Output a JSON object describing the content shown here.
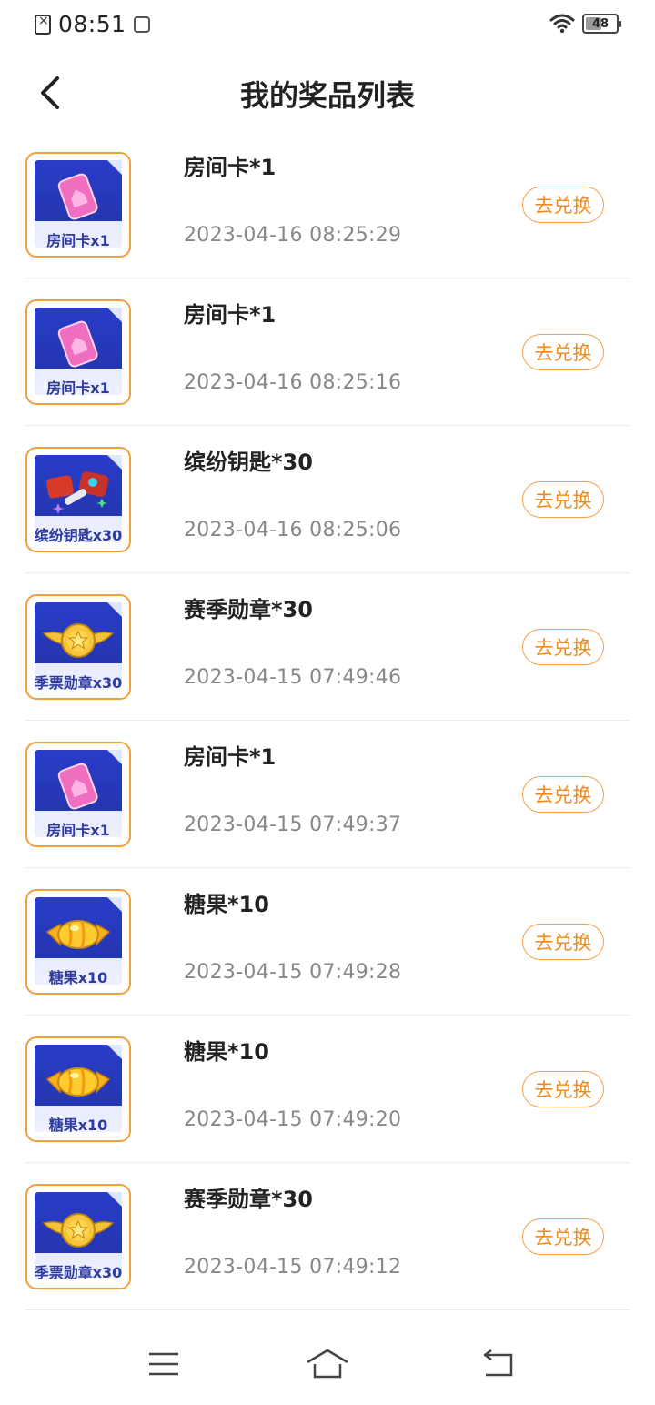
{
  "status_bar": {
    "time": "08:51",
    "battery_level": "48",
    "icons": [
      "notification-icon",
      "app-icon",
      "wifi-icon",
      "battery-icon"
    ]
  },
  "header": {
    "title": "我的奖品列表",
    "back_icon": "chevron-left-icon"
  },
  "items": [
    {
      "name": "房间卡*1",
      "time": "2023-04-16 08:25:29",
      "thumb_caption": "房间卡x1",
      "icon": "room-card-icon",
      "button": "去兑换"
    },
    {
      "name": "房间卡*1",
      "time": "2023-04-16 08:25:16",
      "thumb_caption": "房间卡x1",
      "icon": "room-card-icon",
      "button": "去兑换"
    },
    {
      "name": "缤纷钥匙*30",
      "time": "2023-04-16 08:25:06",
      "thumb_caption": "缤纷钥匙x30",
      "icon": "key-icon",
      "button": "去兑换"
    },
    {
      "name": "赛季勋章*30",
      "time": "2023-04-15 07:49:46",
      "thumb_caption": "季票勋章x30",
      "icon": "medal-icon",
      "button": "去兑换"
    },
    {
      "name": "房间卡*1",
      "time": "2023-04-15 07:49:37",
      "thumb_caption": "房间卡x1",
      "icon": "room-card-icon",
      "button": "去兑换"
    },
    {
      "name": "糖果*10",
      "time": "2023-04-15 07:49:28",
      "thumb_caption": "糖果x10",
      "icon": "candy-icon",
      "button": "去兑换"
    },
    {
      "name": "糖果*10",
      "time": "2023-04-15 07:49:20",
      "thumb_caption": "糖果x10",
      "icon": "candy-icon",
      "button": "去兑换"
    },
    {
      "name": "赛季勋章*30",
      "time": "2023-04-15 07:49:12",
      "thumb_caption": "季票勋章x30",
      "icon": "medal-icon",
      "button": "去兑换"
    }
  ],
  "nav_bar": {
    "icons": [
      "menu-icon",
      "home-icon",
      "back-icon"
    ]
  },
  "colors": {
    "accent": "#ef8a1c",
    "thumb_border": "#f0a03c",
    "thumb_blue": "#2a3cc8"
  }
}
